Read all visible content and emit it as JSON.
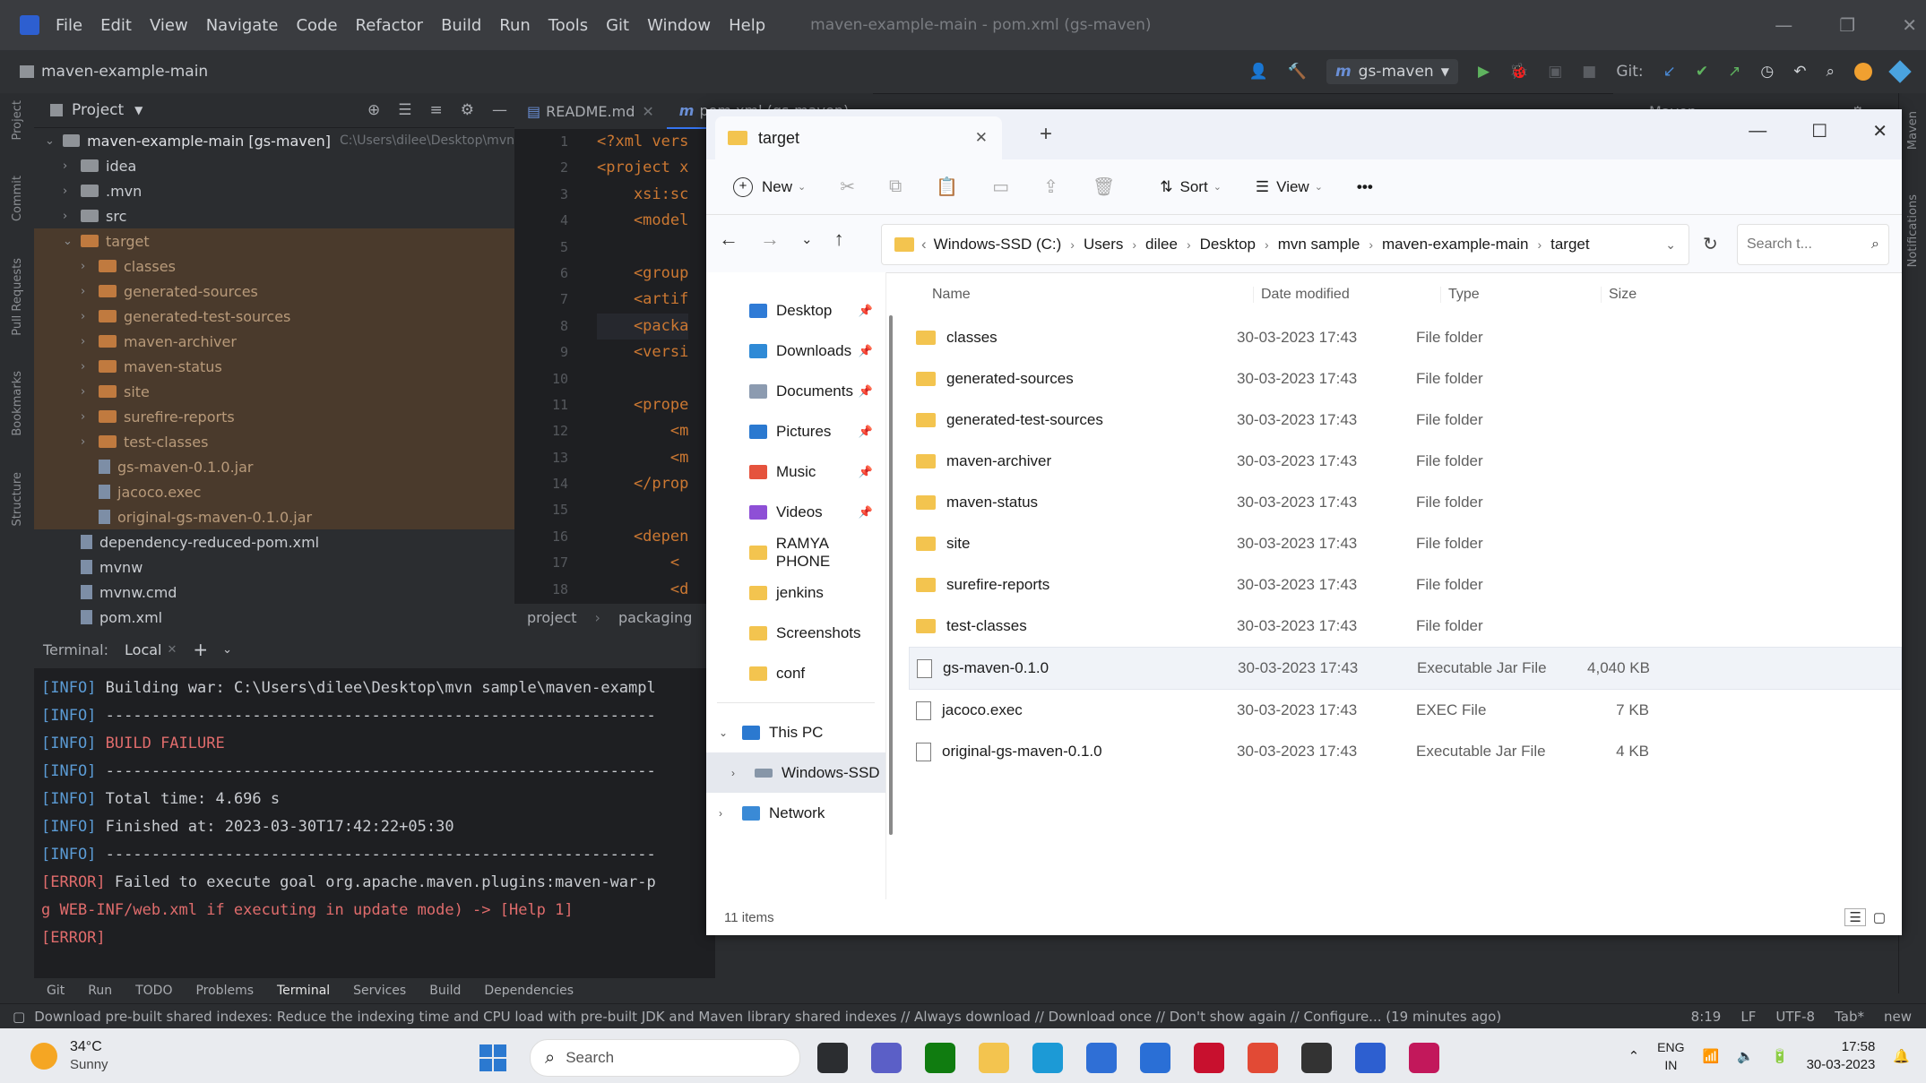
{
  "ide": {
    "menu": [
      "File",
      "Edit",
      "View",
      "Navigate",
      "Code",
      "Refactor",
      "Build",
      "Run",
      "Tools",
      "Git",
      "Window",
      "Help"
    ],
    "window_title": "maven-example-main - pom.xml (gs-maven)",
    "project_name": "maven-example-main",
    "run_config": "gs-maven",
    "git_label": "Git:",
    "project_panel_title": "Project",
    "tabs": [
      "README.md",
      "pom.xml (gs-maven)"
    ],
    "maven_panel": "Maven",
    "tree": {
      "root": "maven-example-main [gs-maven]",
      "root_path": "C:\\Users\\dilee\\Desktop\\mvn",
      "items": [
        {
          "label": "idea",
          "depth": 1,
          "kind": "folder"
        },
        {
          "label": ".mvn",
          "depth": 1,
          "kind": "folder"
        },
        {
          "label": "src",
          "depth": 1,
          "kind": "folder"
        },
        {
          "label": "target",
          "depth": 1,
          "kind": "folder-open"
        },
        {
          "label": "classes",
          "depth": 2,
          "kind": "folder"
        },
        {
          "label": "generated-sources",
          "depth": 2,
          "kind": "folder"
        },
        {
          "label": "generated-test-sources",
          "depth": 2,
          "kind": "folder"
        },
        {
          "label": "maven-archiver",
          "depth": 2,
          "kind": "folder"
        },
        {
          "label": "maven-status",
          "depth": 2,
          "kind": "folder"
        },
        {
          "label": "site",
          "depth": 2,
          "kind": "folder"
        },
        {
          "label": "surefire-reports",
          "depth": 2,
          "kind": "folder"
        },
        {
          "label": "test-classes",
          "depth": 2,
          "kind": "folder"
        },
        {
          "label": "gs-maven-0.1.0.jar",
          "depth": 2,
          "kind": "file"
        },
        {
          "label": "jacoco.exec",
          "depth": 2,
          "kind": "file"
        },
        {
          "label": "original-gs-maven-0.1.0.jar",
          "depth": 2,
          "kind": "file"
        },
        {
          "label": "dependency-reduced-pom.xml",
          "depth": 1,
          "kind": "file"
        },
        {
          "label": "mvnw",
          "depth": 1,
          "kind": "file"
        },
        {
          "label": "mvnw.cmd",
          "depth": 1,
          "kind": "file"
        },
        {
          "label": "pom.xml",
          "depth": 1,
          "kind": "file"
        },
        {
          "label": "README.md",
          "depth": 1,
          "kind": "file"
        }
      ]
    },
    "editor": {
      "line_numbers": [
        "1",
        "2",
        "3",
        "4",
        "5",
        "6",
        "7",
        "8",
        "9",
        "10",
        "11",
        "12",
        "13",
        "14",
        "15",
        "16",
        "17",
        "18"
      ],
      "lines": [
        "<?xml vers",
        "<project x",
        "    xsi:sc",
        "    <model",
        "",
        "    <group",
        "    <artif",
        "    <packa",
        "    <versi",
        "",
        "    <prope",
        "        <m",
        "        <m",
        "    </prop",
        "",
        "    <depen",
        "        <",
        "        <d"
      ],
      "breadcrumb": [
        "project",
        "packaging"
      ]
    },
    "terminal": {
      "title": "Terminal:",
      "tab": "Local",
      "lines": [
        {
          "prefix": "[INFO]",
          "text": " Building war: C:\\Users\\dilee\\Desktop\\mvn sample\\maven-exampl",
          "cls": "info"
        },
        {
          "prefix": "[INFO]",
          "text": " ------------------------------------------------------------",
          "cls": "info"
        },
        {
          "prefix": "[INFO]",
          "text": " BUILD FAILURE",
          "cls": "err"
        },
        {
          "prefix": "[INFO]",
          "text": " ------------------------------------------------------------",
          "cls": "info"
        },
        {
          "prefix": "[INFO]",
          "text": " Total time:  4.696 s",
          "cls": "info"
        },
        {
          "prefix": "[INFO]",
          "text": " Finished at: 2023-03-30T17:42:22+05:30",
          "cls": "info"
        },
        {
          "prefix": "[INFO]",
          "text": " ------------------------------------------------------------",
          "cls": "info"
        },
        {
          "prefix": "[ERROR]",
          "text": " Failed to execute goal org.apache.maven.plugins:maven-war-p",
          "cls": "info"
        },
        {
          "prefix": "",
          "text": "g WEB-INF/web.xml if executing in update mode) -> [Help 1]",
          "cls": "err"
        },
        {
          "prefix": "[ERROR]",
          "text": "",
          "cls": "info"
        }
      ]
    },
    "toolwindows": [
      "Git",
      "Run",
      "TODO",
      "Problems",
      "Terminal",
      "Services",
      "Build",
      "Dependencies"
    ],
    "status_message": "Download pre-built shared indexes: Reduce the indexing time and CPU load with pre-built JDK and Maven library shared indexes // Always download // Download once // Don't show again // Configure... (19 minutes ago)",
    "status_right": [
      "8:19",
      "LF",
      "UTF-8",
      "Tab*",
      "new"
    ],
    "left_strip": [
      "Project",
      "Commit",
      "Pull Requests",
      "Bookmarks",
      "Structure"
    ],
    "right_strip": [
      "Maven",
      "Notifications"
    ]
  },
  "explorer": {
    "tab_title": "target",
    "new_label": "New",
    "sort_label": "Sort",
    "view_label": "View",
    "more": "•••",
    "breadcrumb": [
      "Windows-SSD (C:)",
      "Users",
      "dilee",
      "Desktop",
      "mvn sample",
      "maven-example-main",
      "target"
    ],
    "search_placeholder": "Search t...",
    "columns": {
      "name": "Name",
      "date": "Date modified",
      "type": "Type",
      "size": "Size"
    },
    "nav": [
      {
        "label": "Desktop",
        "pinned": true,
        "color": "#2f7bd6"
      },
      {
        "label": "Downloads",
        "pinned": true,
        "color": "#2f8ad6"
      },
      {
        "label": "Documents",
        "pinned": true,
        "color": "#8c9bb0"
      },
      {
        "label": "Pictures",
        "pinned": true,
        "color": "#2b79d0"
      },
      {
        "label": "Music",
        "pinned": true,
        "color": "#e5533d"
      },
      {
        "label": "Videos",
        "pinned": true,
        "color": "#8e4fd6"
      },
      {
        "label": "RAMYA PHONE",
        "pinned": false,
        "color": "#f3c44f"
      },
      {
        "label": "jenkins",
        "pinned": false,
        "color": "#f3c44f"
      },
      {
        "label": "Screenshots",
        "pinned": false,
        "color": "#f3c44f"
      },
      {
        "label": "conf",
        "pinned": false,
        "color": "#f3c44f"
      }
    ],
    "tree": [
      {
        "label": "This PC"
      },
      {
        "label": "Windows-SSD"
      },
      {
        "label": "Network"
      }
    ],
    "files": [
      {
        "name": "classes",
        "date": "30-03-2023 17:43",
        "type": "File folder",
        "size": "",
        "folder": true
      },
      {
        "name": "generated-sources",
        "date": "30-03-2023 17:43",
        "type": "File folder",
        "size": "",
        "folder": true
      },
      {
        "name": "generated-test-sources",
        "date": "30-03-2023 17:43",
        "type": "File folder",
        "size": "",
        "folder": true
      },
      {
        "name": "maven-archiver",
        "date": "30-03-2023 17:43",
        "type": "File folder",
        "size": "",
        "folder": true
      },
      {
        "name": "maven-status",
        "date": "30-03-2023 17:43",
        "type": "File folder",
        "size": "",
        "folder": true
      },
      {
        "name": "site",
        "date": "30-03-2023 17:43",
        "type": "File folder",
        "size": "",
        "folder": true
      },
      {
        "name": "surefire-reports",
        "date": "30-03-2023 17:43",
        "type": "File folder",
        "size": "",
        "folder": true
      },
      {
        "name": "test-classes",
        "date": "30-03-2023 17:43",
        "type": "File folder",
        "size": "",
        "folder": true
      },
      {
        "name": "gs-maven-0.1.0",
        "date": "30-03-2023 17:43",
        "type": "Executable Jar File",
        "size": "4,040 KB",
        "folder": false
      },
      {
        "name": "jacoco.exec",
        "date": "30-03-2023 17:43",
        "type": "EXEC File",
        "size": "7 KB",
        "folder": false
      },
      {
        "name": "original-gs-maven-0.1.0",
        "date": "30-03-2023 17:43",
        "type": "Executable Jar File",
        "size": "4 KB",
        "folder": false
      }
    ],
    "item_count": "11 items"
  },
  "taskbar": {
    "weather_temp": "34°C",
    "weather_desc": "Sunny",
    "search": "Search",
    "lang": "ENG",
    "lang_region": "IN",
    "time": "17:58",
    "date": "30-03-2023",
    "apps": [
      {
        "name": "file-manager-icon",
        "color": "#2b2d30"
      },
      {
        "name": "chat-icon",
        "color": "#5b5fc7"
      },
      {
        "name": "xbox-icon",
        "color": "#107c10"
      },
      {
        "name": "explorer-icon",
        "color": "#f3c44f"
      },
      {
        "name": "edge-icon",
        "color": "#1c9ad6"
      },
      {
        "name": "store-icon",
        "color": "#2f6fd6"
      },
      {
        "name": "teams-icon",
        "color": "#2a6fd6"
      },
      {
        "name": "mcafee-icon",
        "color": "#c8102e"
      },
      {
        "name": "chrome-icon",
        "color": "#e24a35"
      },
      {
        "name": "terminal-icon",
        "color": "#333"
      },
      {
        "name": "intellij-icon",
        "color": "#2d5fd0"
      },
      {
        "name": "app-icon",
        "color": "#c2185b"
      }
    ]
  }
}
